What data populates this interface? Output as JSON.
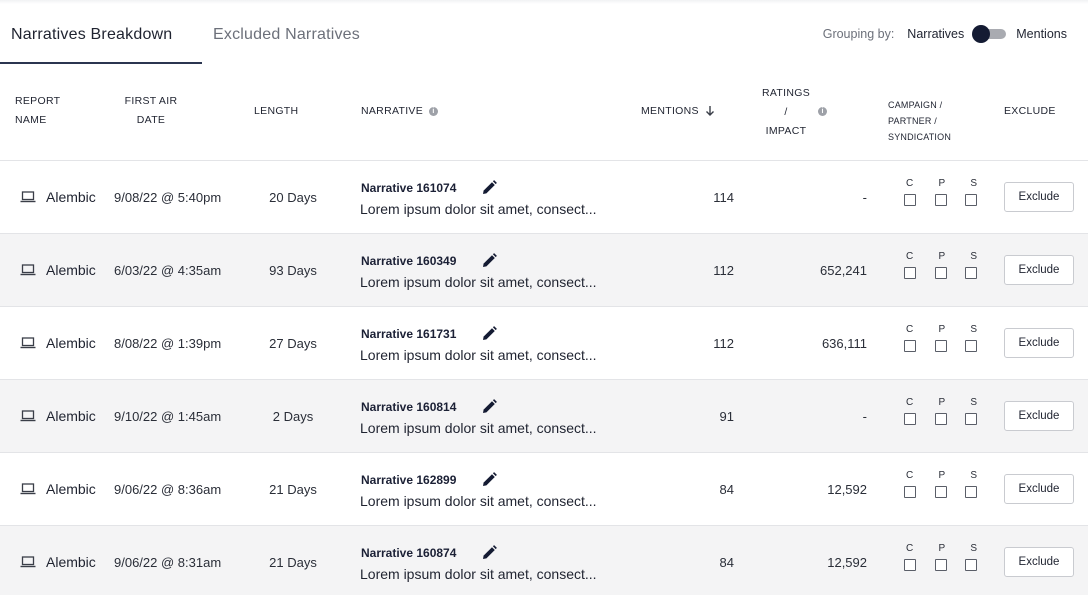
{
  "tabs": [
    {
      "label": "Narratives Breakdown",
      "active": true
    },
    {
      "label": "Excluded Narratives",
      "active": false
    }
  ],
  "grouping": {
    "label": "Grouping by:",
    "option_left": "Narratives",
    "option_right": "Mentions",
    "selected": "Narratives"
  },
  "headers": {
    "report_name": [
      "REPORT",
      "NAME"
    ],
    "first_air_date": [
      "FIRST AIR",
      "DATE"
    ],
    "length": "LENGTH",
    "narrative": "NARRATIVE",
    "mentions": "MENTIONS",
    "ratings": [
      "RATINGS",
      "/",
      "IMPACT"
    ],
    "cps": [
      "CAMPAIGN /",
      "PARTNER /",
      "SYNDICATION"
    ],
    "exclude": "EXCLUDE"
  },
  "checkbox_letters": [
    "C",
    "P",
    "S"
  ],
  "exclude_label": "Exclude",
  "rows": [
    {
      "report": "Alembic",
      "date": "9/08/22 @ 5:40pm",
      "length": "20 Days",
      "narrative": "Narrative 161074",
      "desc": "Lorem ipsum dolor sit amet, consect...",
      "mentions": "114",
      "ratings": "-"
    },
    {
      "report": "Alembic",
      "date": "6/03/22 @ 4:35am",
      "length": "93 Days",
      "narrative": "Narrative 160349",
      "desc": "Lorem ipsum dolor sit amet, consect...",
      "mentions": "112",
      "ratings": "652,241"
    },
    {
      "report": "Alembic",
      "date": "8/08/22 @ 1:39pm",
      "length": "27 Days",
      "narrative": "Narrative 161731",
      "desc": "Lorem ipsum dolor sit amet, consect...",
      "mentions": "112",
      "ratings": "636,111"
    },
    {
      "report": "Alembic",
      "date": "9/10/22 @ 1:45am",
      "length": "2 Days",
      "narrative": "Narrative 160814",
      "desc": "Lorem ipsum dolor sit amet, consect...",
      "mentions": "91",
      "ratings": "-"
    },
    {
      "report": "Alembic",
      "date": "9/06/22 @ 8:36am",
      "length": "21 Days",
      "narrative": "Narrative 162899",
      "desc": "Lorem ipsum dolor sit amet, consect...",
      "mentions": "84",
      "ratings": "12,592"
    },
    {
      "report": "Alembic",
      "date": "9/06/22 @ 8:31am",
      "length": "21 Days",
      "narrative": "Narrative 160874",
      "desc": "Lorem ipsum dolor sit amet, consect...",
      "mentions": "84",
      "ratings": "12,592"
    }
  ],
  "colors": {
    "accent": "#141b33",
    "alt_row": "#f4f4f5",
    "border": "#e3e4e7"
  },
  "icons": {
    "report": "laptop-icon",
    "edit": "pencil-icon",
    "info": "info-icon",
    "sort": "arrow-down-icon"
  }
}
